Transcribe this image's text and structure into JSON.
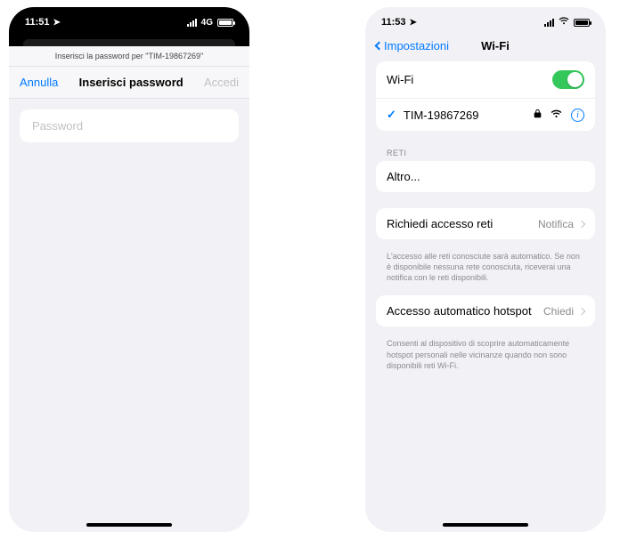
{
  "left": {
    "status": {
      "time": "11:51",
      "network": "4G"
    },
    "modal": {
      "subtitle": "Inserisci la password per \"TIM-19867269\"",
      "cancel": "Annulla",
      "title": "Inserisci password",
      "join": "Accedi",
      "password_placeholder": "Password"
    }
  },
  "right": {
    "status": {
      "time": "11:53"
    },
    "nav": {
      "back": "Impostazioni",
      "title": "Wi-Fi"
    },
    "wifi": {
      "label": "Wi-Fi",
      "connected_network": "TIM-19867269"
    },
    "sections": {
      "networks_header": "RETI",
      "other": "Altro..."
    },
    "ask": {
      "label": "Richiedi accesso reti",
      "value": "Notifica",
      "footer": "L'accesso alle reti conosciute sarà automatico. Se non è disponibile nessuna rete conosciuta, riceverai una notifica con le reti disponibili."
    },
    "hotspot": {
      "label": "Accesso automatico hotspot",
      "value": "Chiedi",
      "footer": "Consenti al dispositivo di scoprire automaticamente hotspot personali nelle vicinanze quando non sono disponibili reti Wi-Fi."
    }
  }
}
